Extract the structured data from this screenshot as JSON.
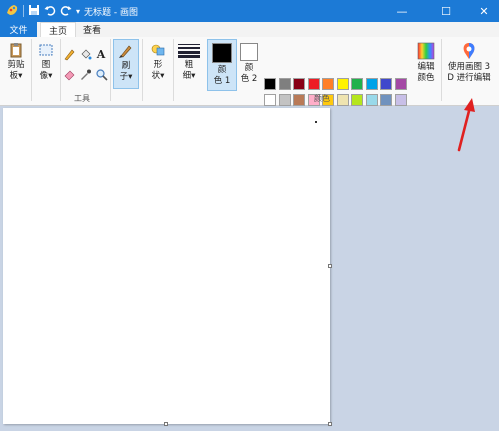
{
  "window": {
    "title": "无标题 - 画图",
    "minimize_glyph": "—",
    "maximize_glyph": "☐",
    "close_glyph": "✕"
  },
  "quick_access": {
    "customize_glyph": "▾"
  },
  "tabs": [
    {
      "label": "文件"
    },
    {
      "label": "主页"
    },
    {
      "label": "查看"
    }
  ],
  "ribbon": {
    "clipboard": {
      "line1": "剪贴",
      "line2": "板▾"
    },
    "image": {
      "line1": "图",
      "line2": "像▾"
    },
    "tools_label": "工具",
    "tools": {
      "text_glyph": "A"
    },
    "brushes": {
      "line1": "刷",
      "line2": "子▾"
    },
    "shapes": {
      "line1": "形",
      "line2": "状▾"
    },
    "size": {
      "line1": "粗",
      "line2": "细▾"
    },
    "color1": {
      "line1": "颜",
      "line2": "色 1",
      "value": "#000000"
    },
    "color2": {
      "line1": "颜",
      "line2": "色 2",
      "value": "#ffffff"
    },
    "palette_label": "颜色",
    "palette_row1": [
      "#000000",
      "#7f7f7f",
      "#880015",
      "#ed1c24",
      "#ff7f27",
      "#fff200",
      "#22b14c",
      "#00a2e8",
      "#3f48cc",
      "#a349a4"
    ],
    "palette_row2": [
      "#ffffff",
      "#c3c3c3",
      "#b97a57",
      "#ffaec9",
      "#ffc90e",
      "#efe4b0",
      "#b5e61d",
      "#99d9ea",
      "#7092be",
      "#c8bfe7"
    ],
    "palette_row3": [
      "#ffffff",
      "#ffffff",
      "#ffffff",
      "#ffffff",
      "#ffffff",
      "#ffffff",
      "#ffffff",
      "#ffffff",
      "#ffffff",
      "#ffffff"
    ],
    "edit_colors": {
      "line1": "编辑",
      "line2": "颜色"
    },
    "paint3d": {
      "line1": "使用画图 3",
      "line2": "D 进行编辑"
    }
  },
  "colors": {
    "accent": "#1c7ad6",
    "workspace": "#c9d4e5",
    "arrow": "#e02020"
  }
}
